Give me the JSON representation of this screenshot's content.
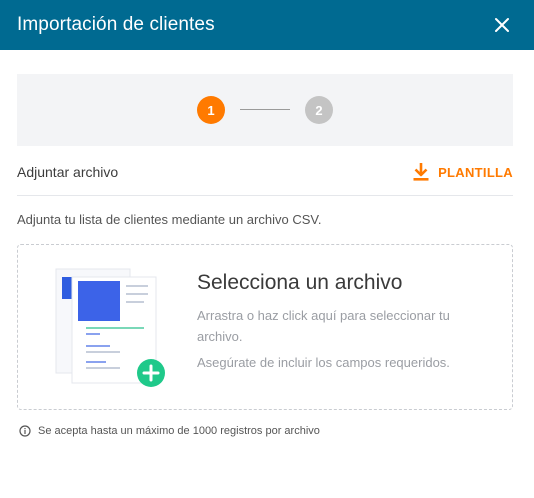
{
  "modal": {
    "title": "Importación de clientes",
    "close_icon": "close-icon"
  },
  "stepper": {
    "steps": [
      {
        "number": "1",
        "state": "active",
        "color": "#ff7a00"
      },
      {
        "number": "2",
        "state": "inactive",
        "color": "#c4c4c4"
      }
    ]
  },
  "attach": {
    "label": "Adjuntar archivo",
    "template_button": "PLANTILLA",
    "template_icon": "download-icon"
  },
  "helper_text": "Adjunta tu lista de clientes mediante un archivo CSV.",
  "dropzone": {
    "title": "Selecciona un archivo",
    "subtitle": "Arrastra o haz click aquí para seleccionar tu archivo.",
    "note": "Asegúrate de incluir los campos requeridos.",
    "illustration": "documents-illustration",
    "add_icon": "plus-circle-icon"
  },
  "footer": {
    "icon": "info-icon",
    "note": "Se acepta hasta un máximo de 1000 registros por archivo"
  },
  "colors": {
    "header": "#006a91",
    "accent": "#ff7a00",
    "success": "#1fc98a"
  }
}
